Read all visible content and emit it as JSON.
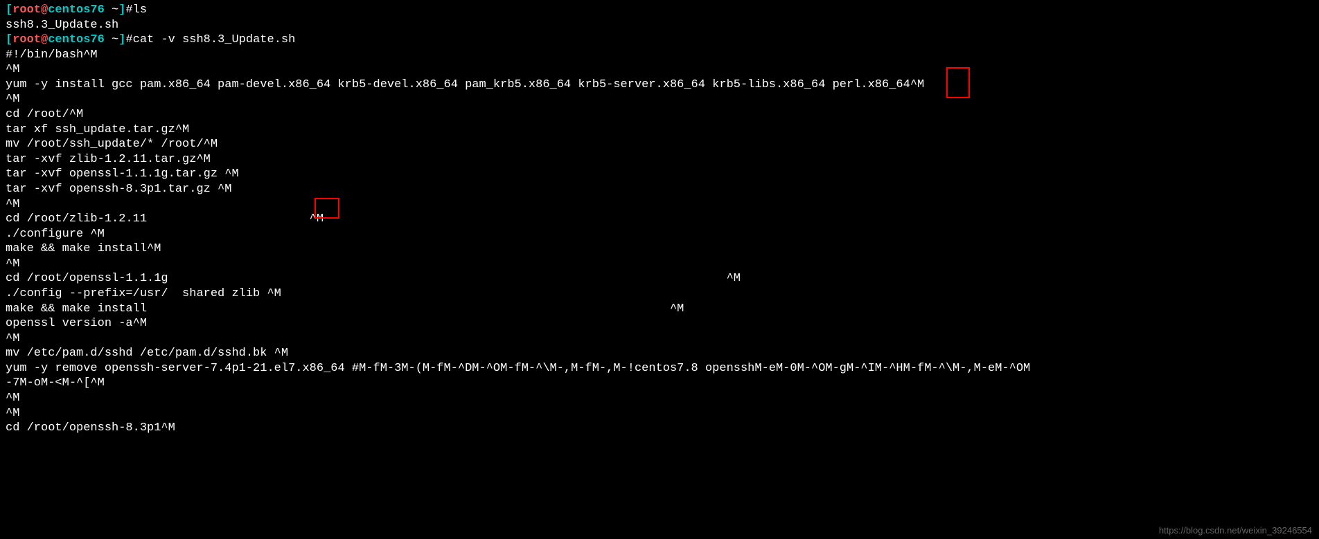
{
  "prompt": {
    "open_bracket": "[",
    "user": "root",
    "at": "@",
    "host": "centos76",
    "space": " ",
    "path": "~",
    "close_bracket": "]",
    "hash": "#"
  },
  "commands": {
    "cmd1": "ls",
    "cmd2": "cat -v ssh8.3_Update.sh"
  },
  "output": {
    "line1": "ssh8.3_Update.sh",
    "line2": "#!/bin/bash^M",
    "line3": "^M",
    "line4": "yum -y install gcc pam.x86_64 pam-devel.x86_64 krb5-devel.x86_64 pam_krb5.x86_64 krb5-server.x86_64 krb5-libs.x86_64 perl.x86_64^M",
    "line5": "^M",
    "line6": "cd /root/^M",
    "line7": "tar xf ssh_update.tar.gz^M",
    "line8": "mv /root/ssh_update/* /root/^M",
    "line9": "tar -xvf zlib-1.2.11.tar.gz^M",
    "line10": "tar -xvf openssl-1.1.1g.tar.gz ^M",
    "line11": "tar -xvf openssh-8.3p1.tar.gz ^M",
    "line12": "^M",
    "line13": "cd /root/zlib-1.2.11                       ^M",
    "line14": "./configure ^M",
    "line15": "make && make install^M",
    "line16": "^M",
    "line17": "cd /root/openssl-1.1.1g                                                                               ^M",
    "line18": "./config --prefix=/usr/  shared zlib ^M",
    "line19": "make && make install                                                                          ^M",
    "line20": "openssl version -a^M",
    "line21": "^M",
    "line22": "mv /etc/pam.d/sshd /etc/pam.d/sshd.bk ^M",
    "line23": "yum -y remove openssh-server-7.4p1-21.el7.x86_64 #M-fM-3M-(M-fM-^DM-^OM-fM-^\\M-,M-fM-,M-!centos7.8 opensshM-eM-0M-^OM-gM-^IM-^HM-fM-^\\M-,M-eM-^OM",
    "line24": "-7M-oM-<M-^[^M",
    "line25": "^M",
    "line26": "^M",
    "line27": "cd /root/openssh-8.3p1^M"
  },
  "watermark": "https://blog.csdn.net/weixin_39246554"
}
